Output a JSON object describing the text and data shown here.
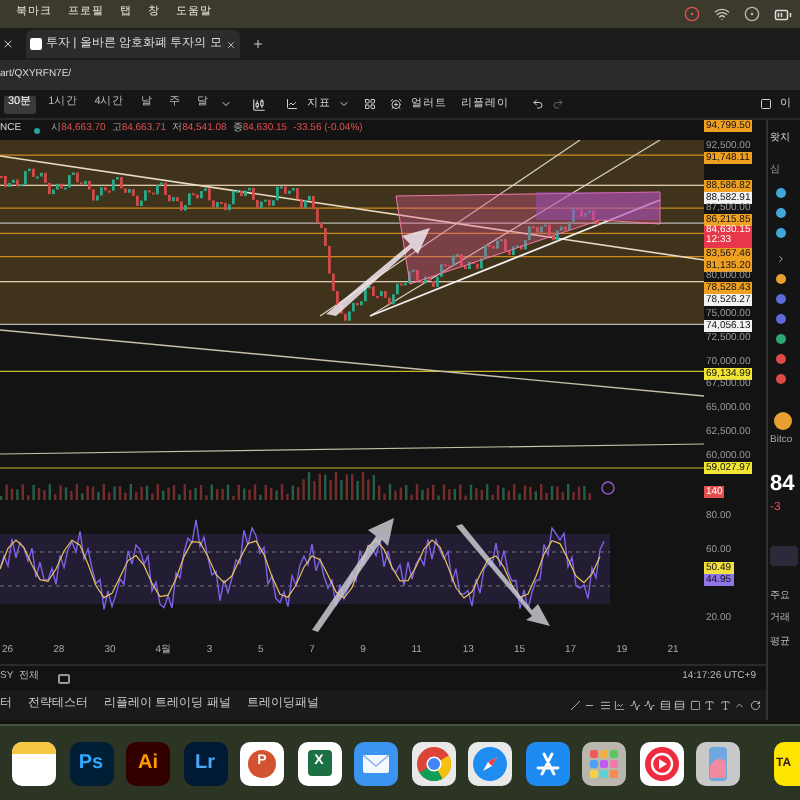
{
  "menu_bar": {
    "items": [
      "북마크",
      "프로필",
      "탭",
      "창",
      "도움말"
    ]
  },
  "browser_tab": {
    "title": "투자 | 올바른 암호화폐 투자의 모"
  },
  "address_bar": {
    "url": "art/QXYRFN7E/"
  },
  "toolbar": {
    "intervals": [
      {
        "label": "30분",
        "selected": true
      },
      {
        "label": "1시간",
        "selected": false
      },
      {
        "label": "4시간",
        "selected": false
      },
      {
        "label": "날",
        "selected": false
      },
      {
        "label": "주",
        "selected": false
      },
      {
        "label": "달",
        "selected": false
      }
    ],
    "indicators": "지표",
    "alert": "얼러트",
    "replay": "리플레이",
    "right": "이"
  },
  "symbol_bar": {
    "symbol": "NCE",
    "ohlc": [
      {
        "label": "시",
        "value": "84,663.70"
      },
      {
        "label": "고",
        "value": "84,663.71"
      },
      {
        "label": "저",
        "value": "84,541.08"
      },
      {
        "label": "종",
        "value": "84,630.15"
      }
    ],
    "change": "-33.56 (-0.04%)"
  },
  "price_axis": [
    {
      "text": "94,799.50",
      "kind": "marker",
      "color": "#f0a020"
    },
    {
      "text": "92,500.00",
      "kind": "grid"
    },
    {
      "text": "91,748.11",
      "kind": "marker",
      "color": "#f0a020"
    },
    {
      "text": "88,586.82",
      "kind": "marker",
      "color": "#f0a020"
    },
    {
      "text": "88,582.91",
      "kind": "line"
    },
    {
      "text": "87,500.00",
      "kind": "grid"
    },
    {
      "text": "86,215.85",
      "kind": "marker",
      "color": "#f0a020"
    },
    {
      "text": "84,630.15",
      "kind": "last",
      "countdown": "12:33"
    },
    {
      "text": "83,567.46",
      "kind": "marker",
      "color": "#f0a020"
    },
    {
      "text": "81,135.20",
      "kind": "marker",
      "color": "#f0a020"
    },
    {
      "text": "80,000.00",
      "kind": "grid"
    },
    {
      "text": "78,528.43",
      "kind": "marker",
      "color": "#f0a020"
    },
    {
      "text": "78,526.27",
      "kind": "line"
    },
    {
      "text": "75,000.00",
      "kind": "grid"
    },
    {
      "text": "74,056.13",
      "kind": "line"
    },
    {
      "text": "72,500.00",
      "kind": "grid"
    },
    {
      "text": "70,000.00",
      "kind": "grid"
    },
    {
      "text": "69,134.99",
      "kind": "marker",
      "color": "#f2e632"
    },
    {
      "text": "67,500.00",
      "kind": "grid"
    },
    {
      "text": "65,000.00",
      "kind": "grid"
    },
    {
      "text": "62,500.00",
      "kind": "grid"
    },
    {
      "text": "60,000.00",
      "kind": "grid"
    },
    {
      "text": "59,027.97",
      "kind": "marker",
      "color": "#f2e632"
    }
  ],
  "volume_label": "140",
  "rsi_axis": [
    {
      "text": "80.00",
      "kind": "grid"
    },
    {
      "text": "60.00",
      "kind": "grid"
    },
    {
      "text": "50.49",
      "kind": "marker",
      "color": "#f2e040"
    },
    {
      "text": "44.95",
      "kind": "marker",
      "color": "#8f74ea"
    },
    {
      "text": "20.00",
      "kind": "grid"
    }
  ],
  "time_axis": [
    "26",
    "28",
    "30",
    "4월",
    "3",
    "5",
    "7",
    "9",
    "11",
    "13",
    "15",
    "17",
    "19",
    "21"
  ],
  "status_bar": {
    "left": [
      "SY",
      "전체"
    ],
    "time": "14:17:26 UTC+9"
  },
  "bottom_tabs": [
    "터",
    "전략테스터",
    "리플레이 트레이딩 패널",
    "트레이딩패널"
  ],
  "sidebar": {
    "title": "왓치",
    "section": "심",
    "asset": "Bitco",
    "price": "84",
    "change": "-3",
    "stats": [
      "주요",
      "거래",
      "평균"
    ]
  },
  "dock": [
    {
      "kind": "notes"
    },
    {
      "kind": "photoshop",
      "text": "Ps"
    },
    {
      "kind": "illustrator",
      "text": "Ai"
    },
    {
      "kind": "lightroom",
      "text": "Lr"
    },
    {
      "kind": "powerpoint",
      "text": "P"
    },
    {
      "kind": "excel",
      "text": "X"
    },
    {
      "kind": "mail"
    },
    {
      "kind": "chrome"
    },
    {
      "kind": "safari"
    },
    {
      "kind": "appstore"
    },
    {
      "kind": "launchpad"
    },
    {
      "kind": "music"
    },
    {
      "kind": "phone"
    },
    {
      "kind": "kakao",
      "text": "TA"
    }
  ]
}
